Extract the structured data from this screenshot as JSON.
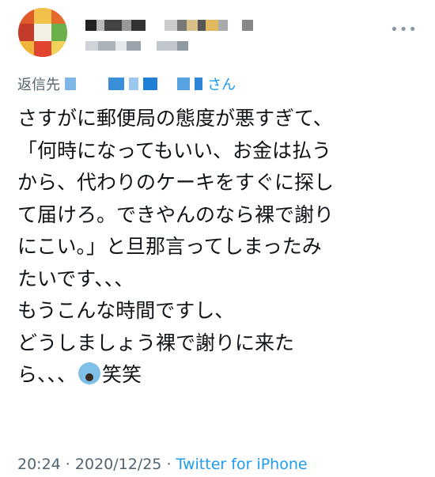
{
  "tweet": {
    "reply_prefix": "返信先",
    "reply_suffix": "さん",
    "lines": [
      "さすがに郵便局の態度が悪すぎて、",
      "「何時になってもいい、お金は払う",
      "から、代わりのケーキをすぐに探し",
      "て届けろ。できやんのなら裸で謝り",
      "にこい。」と旦那言ってしまったみ",
      "たいです、、、",
      "もうこんな時間ですし、",
      "どうしましょう裸で謝りに来た",
      "ら、、、"
    ],
    "last_line_suffix": "笑笑",
    "emoji_icon": "face-screaming-in-fear-icon",
    "time": "20:24",
    "separator": " · ",
    "date": "2020/12/25",
    "source": "Twitter for iPhone"
  },
  "header": {
    "more_label": "•••"
  },
  "colors": {
    "link": "#1d9bf0",
    "secondary": "#536471",
    "text": "#0f1419"
  }
}
